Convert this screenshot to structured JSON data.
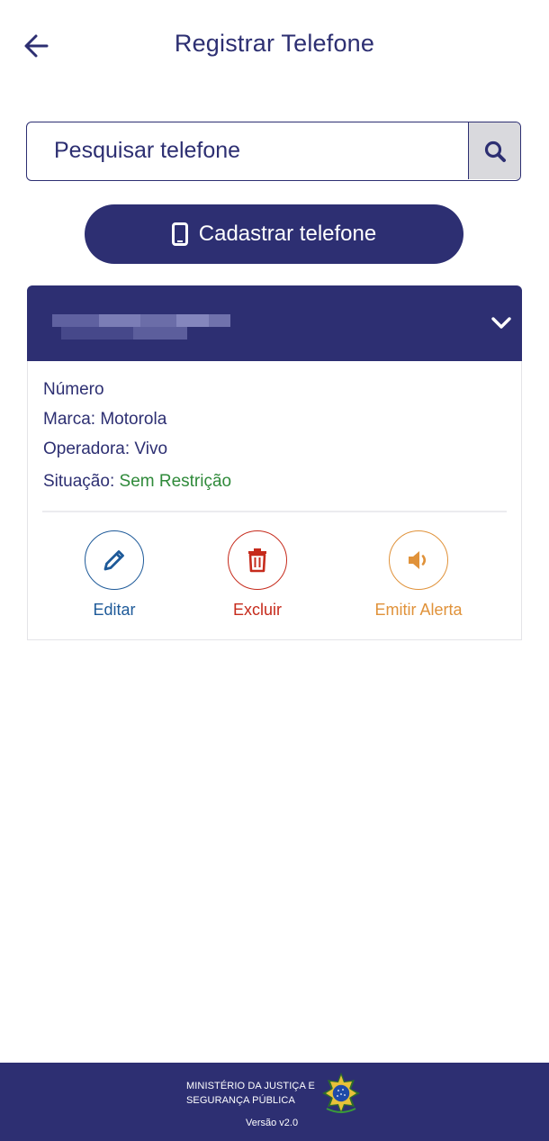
{
  "header": {
    "title": "Registrar Telefone",
    "back_icon": "arrow-left-icon"
  },
  "search": {
    "placeholder": "Pesquisar telefone",
    "value": "",
    "icon": "search-icon"
  },
  "add_button": {
    "label": "Cadastrar telefone",
    "icon": "mobile-phone-icon"
  },
  "card": {
    "title": "",
    "expand_icon": "chevron-down-icon",
    "number_label": "Número",
    "brand_label": "Marca:",
    "brand_value": "Motorola",
    "carrier_label": "Operadora:",
    "carrier_value": "Vivo",
    "status_label": "Situação:",
    "status_value": "Sem Restrição",
    "actions": {
      "edit": {
        "label": "Editar",
        "icon": "pencil-icon",
        "color": "#1e5a99"
      },
      "delete": {
        "label": "Excluir",
        "icon": "trash-icon",
        "color": "#c62b1c"
      },
      "alert": {
        "label": "Emitir Alerta",
        "icon": "speaker-icon",
        "color": "#e0923a"
      }
    }
  },
  "footer": {
    "ministry_line1": "MINISTÉRIO DA JUSTIÇA E",
    "ministry_line2": "SEGURANÇA PÚBLICA",
    "version": "Versão v2.0",
    "emblem_icon": "brazil-coat-of-arms-icon"
  },
  "colors": {
    "primary": "#2d2f72",
    "success": "#2f8a3a",
    "edit": "#1e5a99",
    "delete": "#c62b1c",
    "alert": "#e0923a"
  }
}
